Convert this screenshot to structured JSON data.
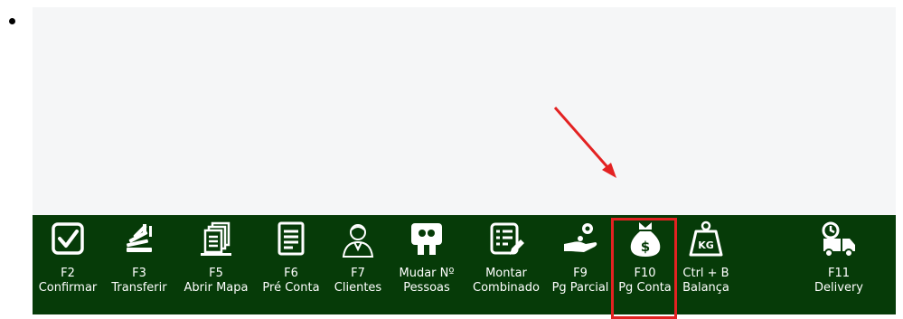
{
  "colors": {
    "toolbar_bg": "#063b08",
    "panel_bg": "#f5f6f7",
    "highlight": "#e32222",
    "arrow": "#e32222"
  },
  "toolbar": {
    "buttons": [
      {
        "id": "f2",
        "key": "F2",
        "label": "Confirmar",
        "icon": "checkbox-icon"
      },
      {
        "id": "f3",
        "key": "F3",
        "label": "Transferir",
        "icon": "transfer-icon"
      },
      {
        "id": "f5",
        "key": "F5",
        "label": "Abrir Mapa",
        "icon": "copies-icon"
      },
      {
        "id": "f6",
        "key": "F6",
        "label": "Pré Conta",
        "icon": "document-icon"
      },
      {
        "id": "f7",
        "key": "F7",
        "label": "Clientes",
        "icon": "person-icon"
      },
      {
        "id": "np",
        "key": "Mudar Nº",
        "label": "Pessoas",
        "icon": "people-sign-icon"
      },
      {
        "id": "mc",
        "key": "Montar",
        "label": "Combinado",
        "icon": "list-edit-icon"
      },
      {
        "id": "f9",
        "key": "F9",
        "label": "Pg Parcial",
        "icon": "hand-coin-icon"
      },
      {
        "id": "f10",
        "key": "F10",
        "label": "Pg Conta",
        "icon": "money-bag-icon"
      },
      {
        "id": "cb",
        "key": "Ctrl + B",
        "label": "Balança",
        "icon": "weight-kg-icon"
      },
      {
        "id": "f11",
        "key": "F11",
        "label": "Delivery",
        "icon": "delivery-truck-icon"
      }
    ]
  }
}
